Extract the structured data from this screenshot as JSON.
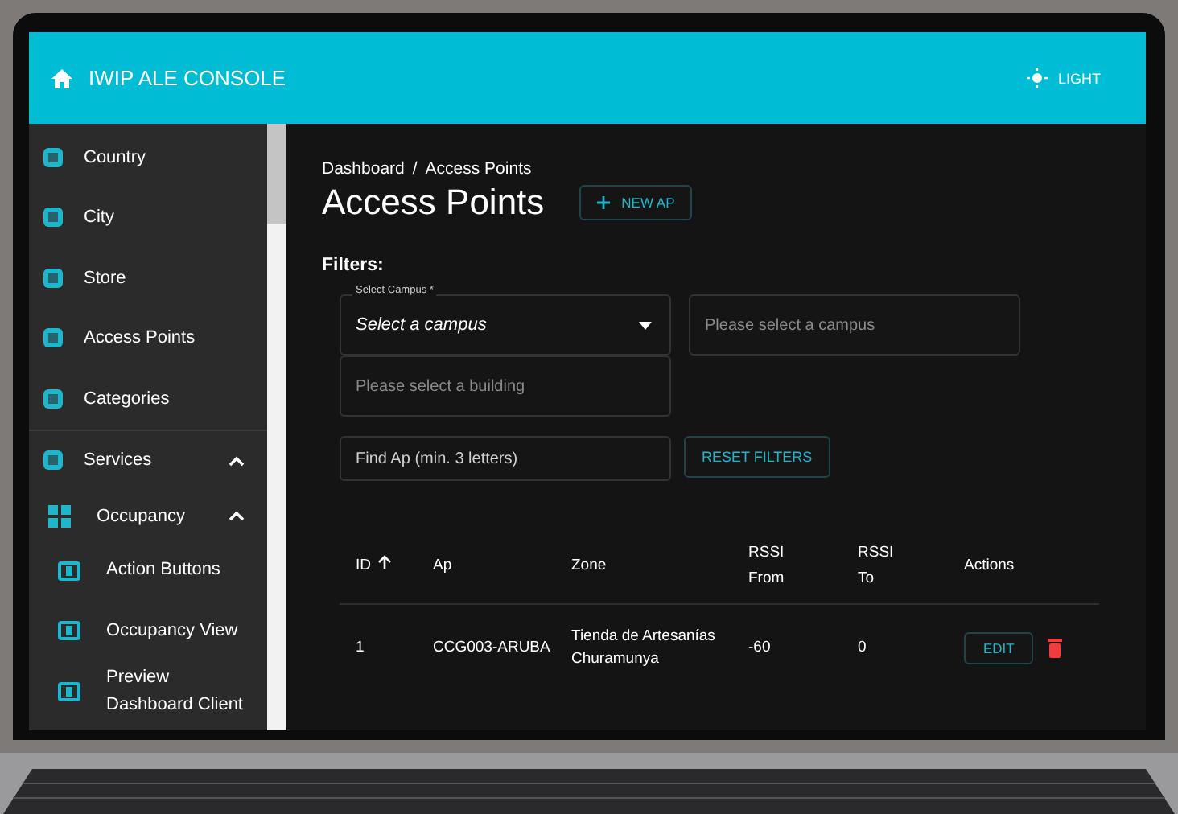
{
  "app_bar": {
    "title": "IWIP ALE CONSOLE",
    "theme_button": "LIGHT"
  },
  "sidebar": {
    "items": [
      {
        "label": "Country"
      },
      {
        "label": "City"
      },
      {
        "label": "Store"
      },
      {
        "label": "Access Points"
      },
      {
        "label": "Categories"
      },
      {
        "label": "Services",
        "expanded": true,
        "children": [
          {
            "label": "Occupancy",
            "expanded": true,
            "children": [
              {
                "label": "Action Buttons"
              },
              {
                "label": "Occupancy View"
              },
              {
                "label": "Preview Dashboard Client"
              }
            ]
          }
        ]
      }
    ]
  },
  "breadcrumb": [
    "Dashboard",
    "Access Points"
  ],
  "breadcrumb_separator": "/",
  "page_title": "Access Points",
  "new_button": "NEW AP",
  "filters": {
    "heading": "Filters:",
    "campus_select": {
      "label": "Select Campus *",
      "value": "Select a campus"
    },
    "campus_field": {
      "placeholder": "Please select a campus"
    },
    "building_field": {
      "placeholder": "Please select a building"
    },
    "search_field": {
      "placeholder": "Find Ap (min. 3 letters)"
    },
    "reset_button": "RESET FILTERS"
  },
  "table": {
    "columns": [
      {
        "label": "ID",
        "sorted": true
      },
      {
        "label": "Ap",
        "sorted": false
      },
      {
        "label": "Zone",
        "sorted": false
      },
      {
        "label": "RSSI From",
        "sorted": false
      },
      {
        "label": "RSSI To",
        "sorted": false
      },
      {
        "label": "Actions",
        "sorted": false
      }
    ],
    "rows": [
      {
        "cells": [
          "1",
          "CCG003-ARUBA",
          "Tienda de Artesanías Churamunya",
          "-60",
          "0"
        ],
        "edit_button": "EDIT"
      }
    ]
  }
}
